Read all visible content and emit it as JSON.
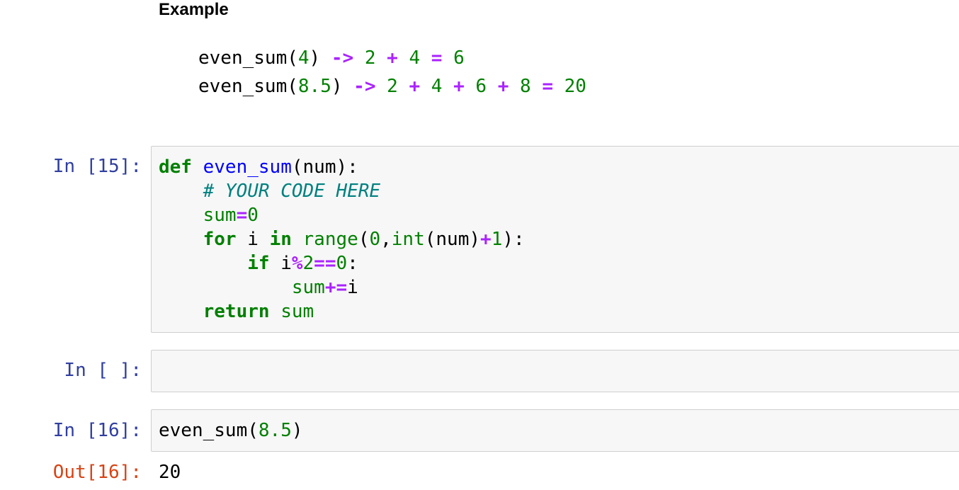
{
  "markdown": {
    "heading": "Example",
    "example_lines": [
      {
        "call": "even_sum",
        "arg": "4",
        "arrow": "->",
        "terms": [
          "2",
          "4"
        ],
        "plus": "+",
        "eq": "=",
        "result": "6"
      },
      {
        "call": "even_sum",
        "arg": "8.5",
        "arrow": "->",
        "terms": [
          "2",
          "4",
          "6",
          "8"
        ],
        "plus": "+",
        "eq": "=",
        "result": "20"
      }
    ]
  },
  "cells": [
    {
      "prompt": "In [15]:",
      "code": {
        "line1": {
          "kw_def": "def",
          "fname": "even_sum",
          "params": "(num):"
        },
        "line2": {
          "comment": "# YOUR CODE HERE"
        },
        "line3": {
          "var": "sum",
          "op": "=",
          "num": "0"
        },
        "line4": {
          "kw_for": "for",
          "var": " i ",
          "kw_in": "in",
          "range_fn": "range",
          "open": "(",
          "zero": "0",
          "comma": ",",
          "int_fn": "int",
          "arg": "(num)",
          "plus": "+",
          "one": "1",
          "close": "):"
        },
        "line5": {
          "kw_if": "if",
          "var": " i",
          "mod": "%",
          "two": "2",
          "eqeq": "==",
          "zero": "0",
          "colon": ":"
        },
        "line6": {
          "var": "sum",
          "op": "+=",
          "rhs": "i"
        },
        "line7": {
          "kw_return": "return",
          "var": "sum"
        }
      }
    },
    {
      "prompt": "In [ ]:",
      "code": ""
    },
    {
      "prompt": "In [16]:",
      "code": {
        "call": "even_sum",
        "open": "(",
        "arg": "8.5",
        "close": ")"
      },
      "out_prompt": "Out[16]:",
      "output": "20"
    }
  ]
}
